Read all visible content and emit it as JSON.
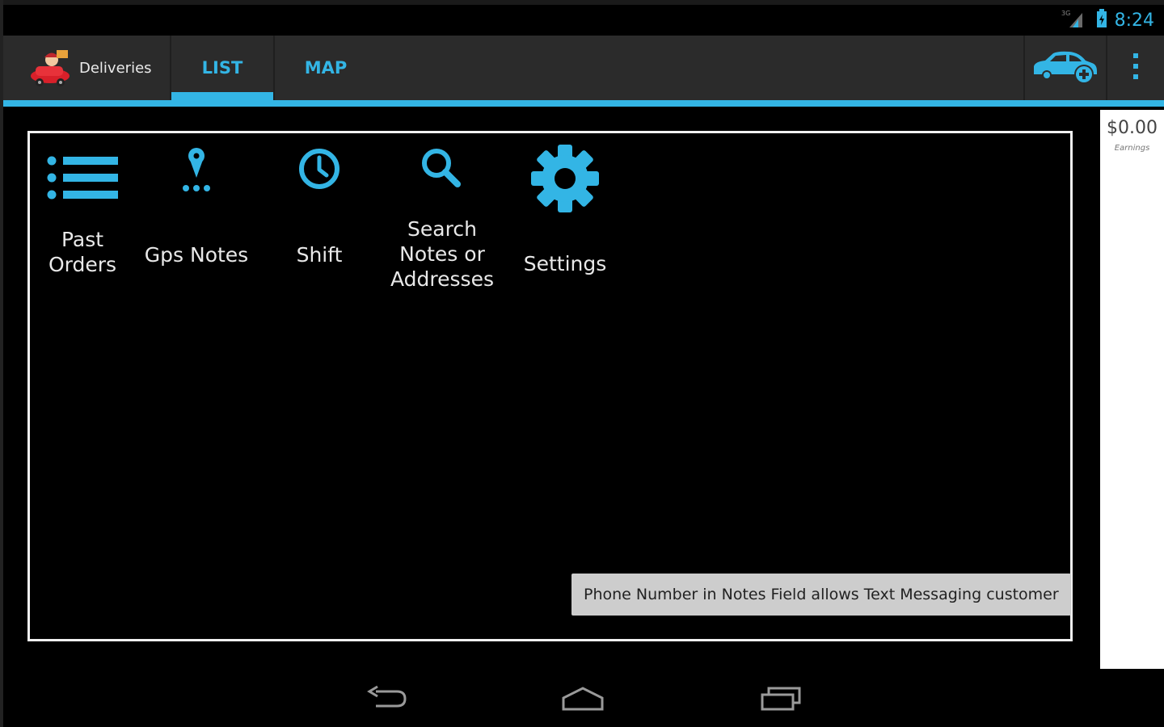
{
  "status_bar": {
    "time": "8:24",
    "signal_badge": "3G"
  },
  "action_bar": {
    "app_title": "Deliveries",
    "tabs": [
      {
        "label": "LIST",
        "selected": true
      },
      {
        "label": "MAP",
        "selected": false
      }
    ]
  },
  "menu": {
    "items": [
      {
        "icon": "list-icon",
        "lines": [
          "Past",
          "Orders"
        ]
      },
      {
        "icon": "gps-pin-icon",
        "lines": [
          "Gps Notes"
        ]
      },
      {
        "icon": "clock-icon",
        "lines": [
          "Shift"
        ]
      },
      {
        "icon": "search-icon",
        "lines": [
          "Search",
          "Notes or",
          "Addresses"
        ]
      },
      {
        "icon": "gear-icon",
        "lines": [
          "Settings"
        ]
      }
    ]
  },
  "earnings": {
    "value": "$0.00",
    "label": "Earnings"
  },
  "toast": {
    "text": "Phone Number in Notes Field allows Text Messaging customer"
  },
  "colors": {
    "accent": "#33b5e5",
    "action_bar": "#2b2b2b",
    "background": "#000000",
    "toast": "#cdcdcd"
  }
}
